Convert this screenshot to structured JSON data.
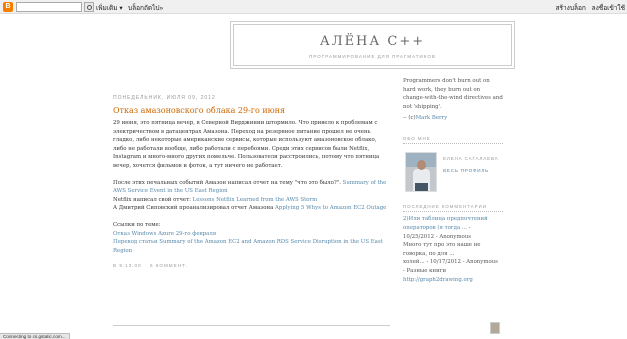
{
  "navbar": {
    "logo": "B",
    "more": "เพิ่มเติม ▾",
    "report": "บล็อกถัดไป»",
    "create": "สร้างบล็อก",
    "signin": "ลงชื่อเข้าใช้"
  },
  "header": {
    "title": "АЛЁНА С++",
    "description": "ПРОГРАММИРОВАНИЕ ДЛЯ ПРАГМАТИКОВ"
  },
  "post": {
    "date": "ПОНЕДЕЛЬНИК, ИЮЛЯ 09, 2012",
    "title": "Отказ амазоновского облака 29-го июня",
    "p1": "29 июня, это пятница вечер, в Северной Вирджинии штормило. Что привело к проблемам с электричеством в датацентрах Амазона. Переход на резервное питание прошел не очень гладко, либо некоторые американские сервисы, которые используют амазоновское облако, либо не работали вообще, либо работали с перебоями. Среди этих сервисов были Netflix, Instagram и много-много других помельче. Пользователи расстроились, потому что пятница вечер, хочется фильмов и фоток, а тут ничего не работает.",
    "p2_text": "После этих печальных событий Амазон написал отчет на тему \"что это было?\". ",
    "p2_link": "Summary of the AWS Service Event in the US East Region",
    "p3_text": "Netflix написал свой отчет: ",
    "p3_link": "Lessons Netflix Learned from the AWS Storm",
    "p4_text": "А Дмитрий Сиповский проанализировал отчет Амазона ",
    "p4_link": "Applying 5 Whys to Amazon EC2 Outage",
    "links_title": "Ссылки по теме:",
    "link1": "Отказ Windows Azure 29-го февраля",
    "link2": "Перевод статьи Summary of the Amazon EC2 and Amazon RDS Service Disruption in the US East Region",
    "footer_time": "В 9:13:00",
    "footer_comments": "6 КОММЕНТ."
  },
  "sidebar": {
    "quote": "Programmers don't burn out on hard work, they burn out on change-with-the-wind directives and not 'shipping'.",
    "quote_prefix": "-- (c)",
    "quote_author": "Mark Berry",
    "about_title": "ОБО МНЕ",
    "profile_name": "ЕЛЕНА САГАЛАЕВА",
    "profile_link": "ВЕСЬ ПРОФИЛЬ",
    "comments_title": "ПОСЛЕДНИЕ КОММЕНТАРИИ",
    "c1_link": "2)Или таблица предпочтений операторов (я тогда ...",
    "c1_meta": " - 10/25/2012 - Anonymous",
    "c2_text": "Много тут про это наше не говорка, по для ...",
    "c2_meta": "холей... - 10/17/2012 - Anonymous",
    "c3_text": "- Разные книги",
    "c3_link": "http://graph2drawing.org"
  },
  "status": {
    "text": "Connecting to cs.gstatic.com..."
  }
}
